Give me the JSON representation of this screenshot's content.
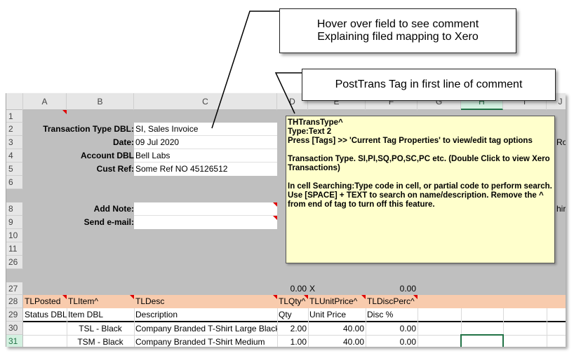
{
  "callouts": {
    "hover_line1": "Hover over field to see comment",
    "hover_line2": "Explaining filed mapping to Xero",
    "posttrans": "PostTrans Tag in first line of comment"
  },
  "columns": [
    "A",
    "B",
    "C",
    "D",
    "E",
    "F",
    "G",
    "H",
    "I",
    "J"
  ],
  "rows": [
    "1",
    "2",
    "3",
    "4",
    "5",
    "6",
    "8",
    "9",
    "10",
    "11",
    "26",
    "27",
    "28",
    "29",
    "30",
    "31"
  ],
  "form": {
    "transaction_type_label": "Transaction Type DBL:",
    "transaction_type_value": "SI, Sales Invoice",
    "date_label": "Date:",
    "date_value": "09 Jul 2020",
    "account_label": "Account DBL",
    "account_value": "Bell Labs",
    "cust_ref_label": "Cust Ref:",
    "cust_ref_value": "Some Ref NO 45126512",
    "add_note_label": "Add Note:",
    "add_note_value": "",
    "send_email_label": "Send e-mail:",
    "send_email_value": ""
  },
  "right_clip": {
    "row3": "Ro",
    "row8": "hire"
  },
  "row27": {
    "d": "0.00",
    "e": "X",
    "f": "0.00"
  },
  "tag_headers": [
    "TLPosted",
    "TLItem^",
    "TLDesc",
    "TLQty^",
    "TLUnitPrice^",
    "TLDiscPerc^"
  ],
  "friendly_headers": [
    "Status DBL",
    "Item DBL",
    "Description",
    "Qty",
    "Unit Price",
    "Disc %"
  ],
  "lines": [
    {
      "item": "TSL - Black",
      "desc": "Company Branded T-Shirt Large Black",
      "qty": "2.00",
      "price": "40.00",
      "disc": "0.00"
    },
    {
      "item": "TSM - Black",
      "desc": "Company Branded T-Shirt Medium",
      "qty": "1.00",
      "price": "40.00",
      "disc": "0.00"
    }
  ],
  "comment": {
    "tag": "THTransType^",
    "type": "Type:Text 2",
    "press": "Press [Tags] >> 'Current Tag Properties' to view/edit tag options",
    "desc": "Transaction Type. SI,PI,SQ,PO,SC,PC etc. (Double Click to view Xero Transactions)",
    "search": "In cell Searching:Type code in cell, or partial code to perform search.  Use [SPACE] + TEXT to search on name/description. Remove the ^ from end of tag to turn off this feature."
  }
}
